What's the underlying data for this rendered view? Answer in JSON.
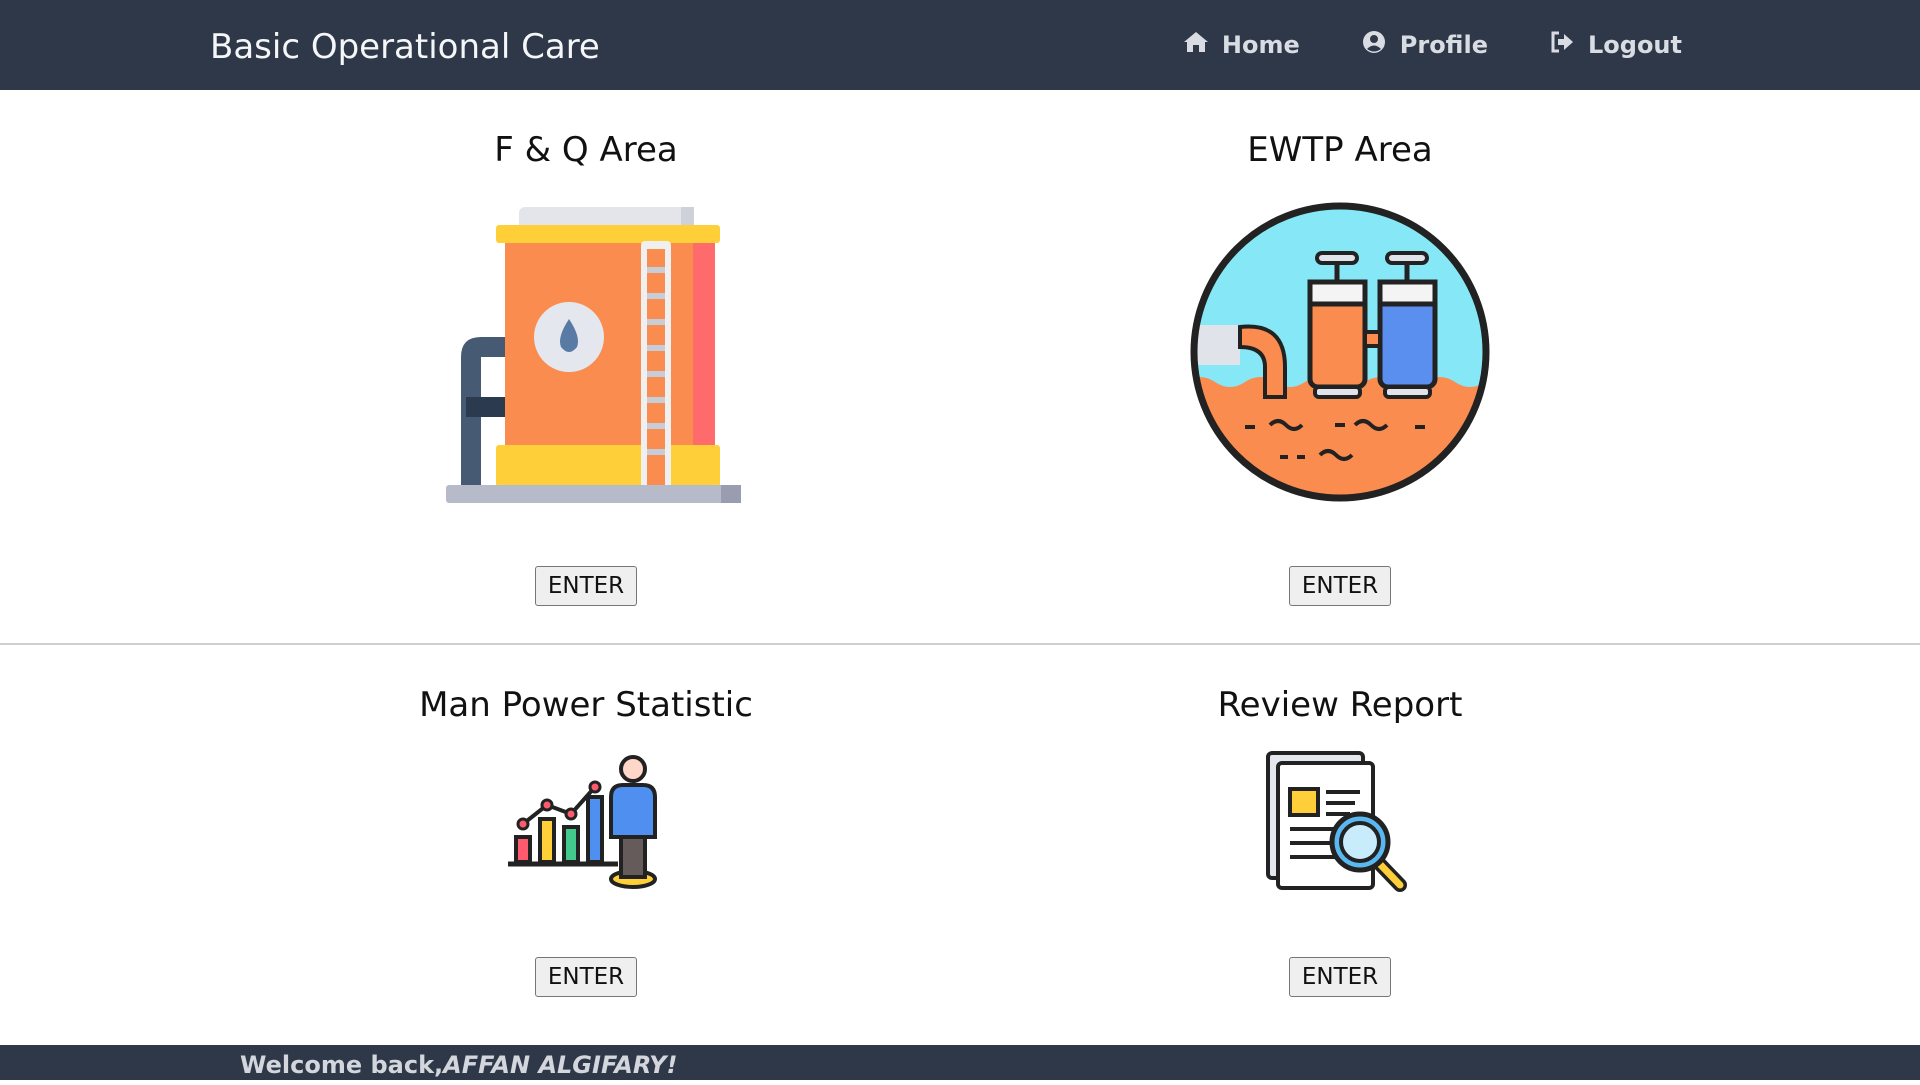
{
  "header": {
    "title": "Basic Operational Care",
    "nav": [
      {
        "label": "Home",
        "icon": "home-icon"
      },
      {
        "label": "Profile",
        "icon": "user-circle-icon"
      },
      {
        "label": "Logout",
        "icon": "logout-icon"
      }
    ]
  },
  "cards": [
    {
      "title": "F & Q Area",
      "button": "ENTER",
      "icon": "fuel-tank-icon"
    },
    {
      "title": "EWTP Area",
      "button": "ENTER",
      "icon": "wastewater-treatment-icon"
    },
    {
      "title": "Man Power Statistic",
      "button": "ENTER",
      "icon": "man-power-chart-icon"
    },
    {
      "title": "Review Report",
      "button": "ENTER",
      "icon": "report-search-icon"
    }
  ],
  "footer": {
    "prefix": "Welcome back,",
    "user": "AFFAN ALGIFARY!"
  },
  "colors": {
    "navbar": "#2f3848",
    "tank_body": "#fb8c4f",
    "tank_band": "#ffcf39",
    "water": "#86e8f6"
  }
}
